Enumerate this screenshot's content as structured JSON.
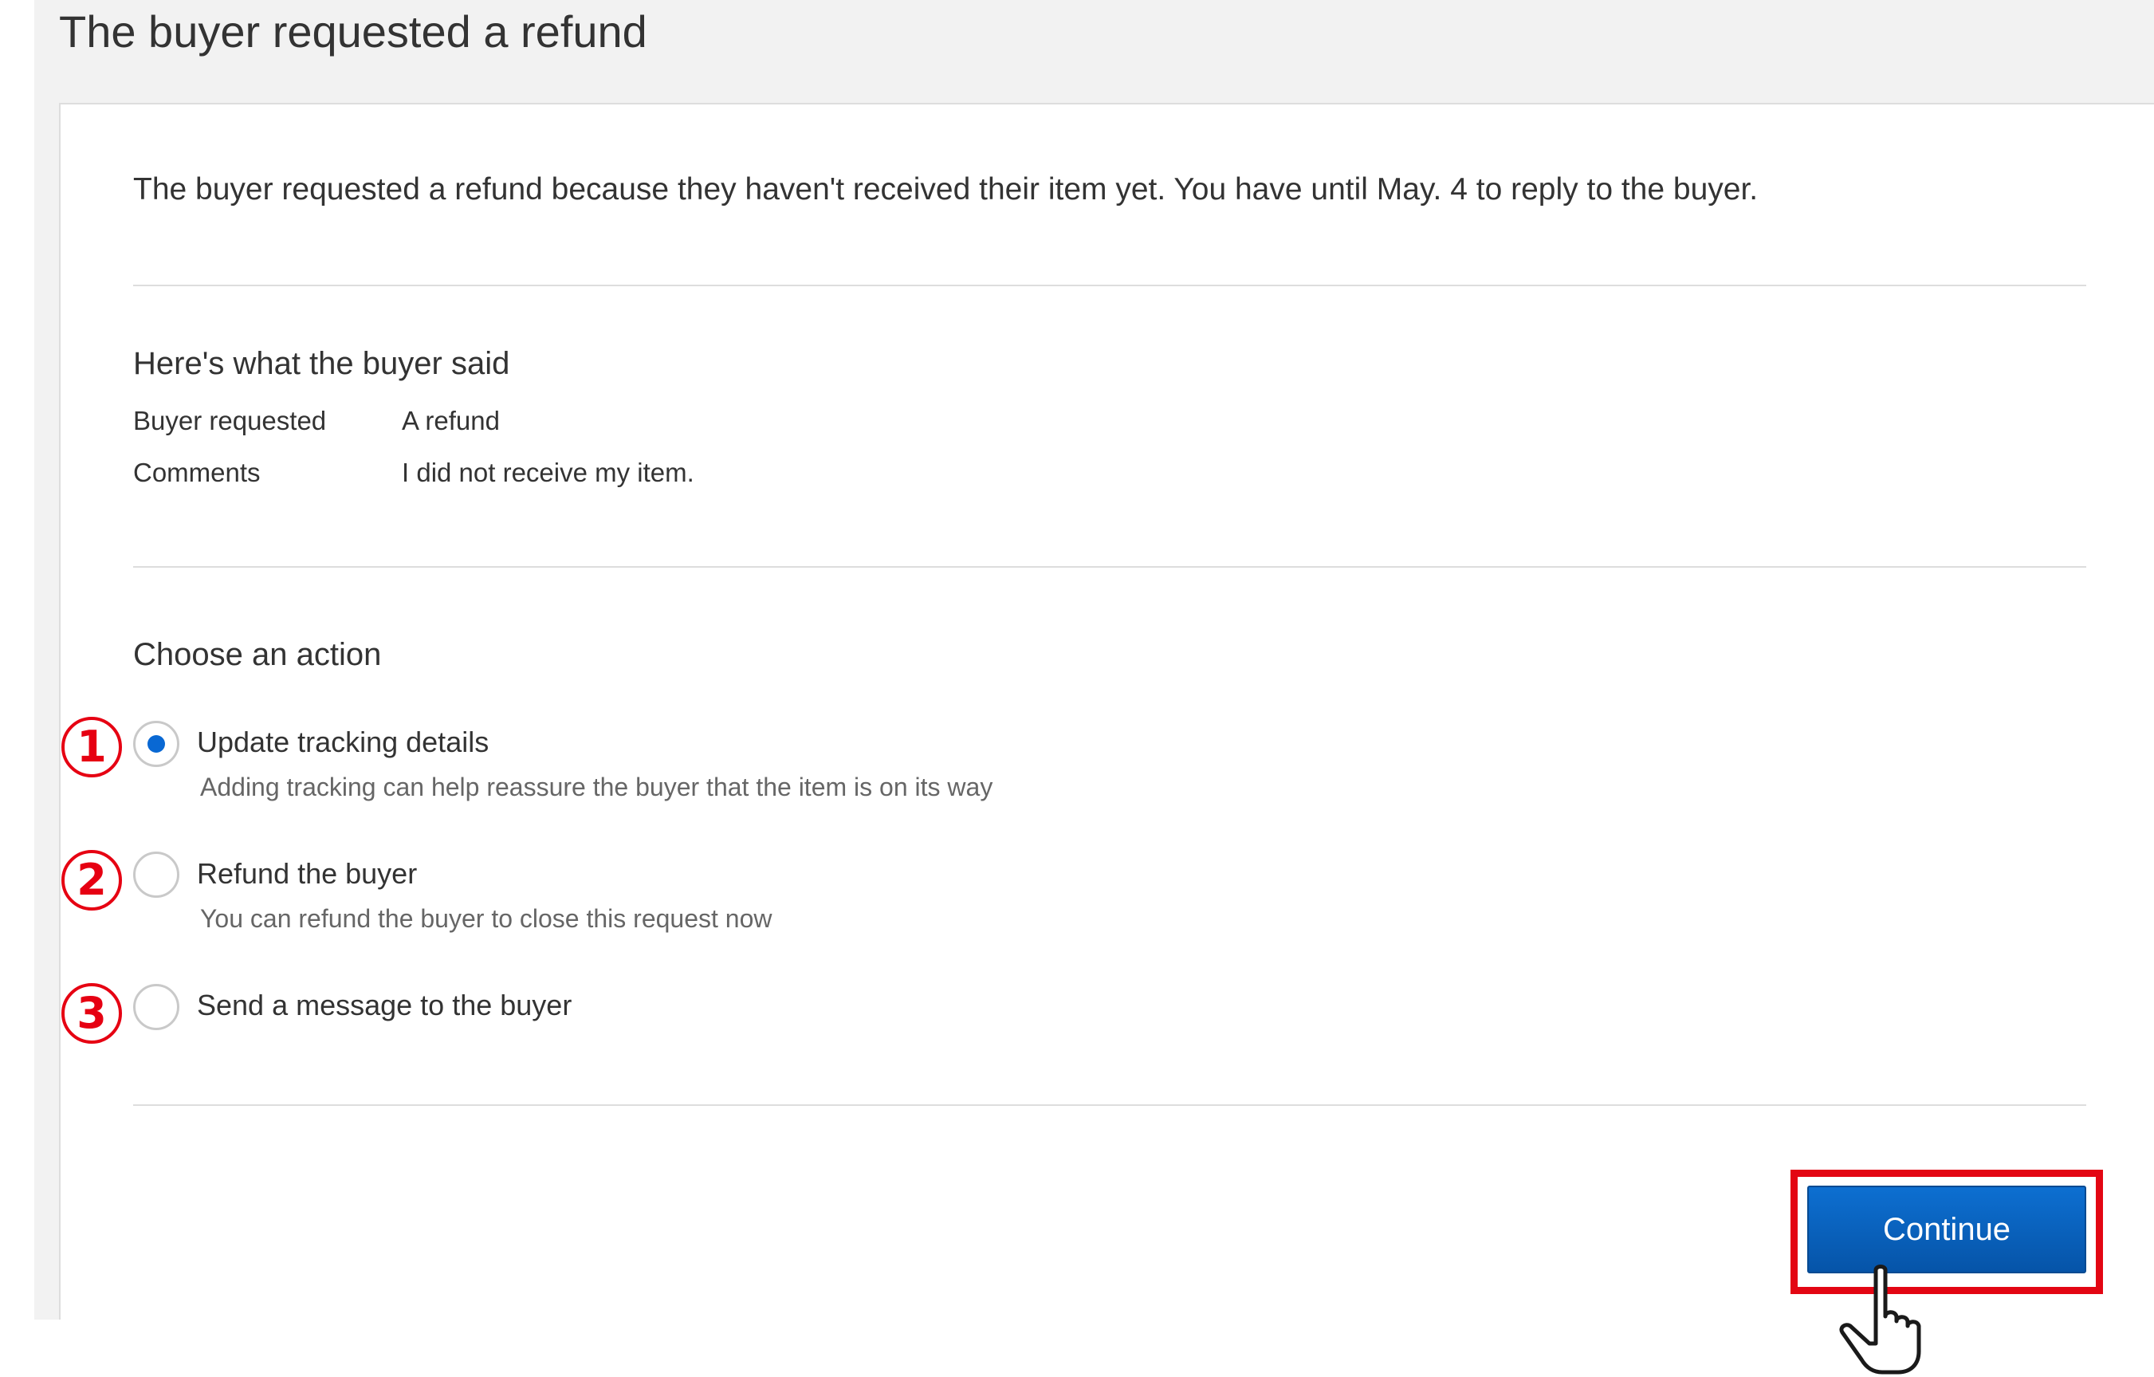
{
  "page": {
    "title": "The buyer requested a refund",
    "intro": "The buyer requested a refund because they haven't received their item yet. You have until May. 4 to reply to the buyer."
  },
  "buyer_said": {
    "heading": "Here's what the buyer said",
    "rows": [
      {
        "label": "Buyer requested",
        "value": "A refund"
      },
      {
        "label": "Comments",
        "value": "I did not receive my item."
      }
    ]
  },
  "actions": {
    "heading": "Choose an action",
    "selected_index": 0,
    "options": [
      {
        "step": "1",
        "label": "Update tracking details",
        "hint": "Adding tracking can help reassure the buyer that the item is on its way",
        "selected": true
      },
      {
        "step": "2",
        "label": "Refund the buyer",
        "hint": "You can refund the buyer to close this request now",
        "selected": false
      },
      {
        "step": "3",
        "label": "Send a message to the buyer",
        "selected": false
      }
    ]
  },
  "footer": {
    "continue_label": "Continue"
  },
  "colors": {
    "annotation_red": "#e60012",
    "button_blue": "#0968d3",
    "radio_selected": "#0968d3"
  },
  "icons": {
    "cursor": "hand-pointer-icon"
  }
}
